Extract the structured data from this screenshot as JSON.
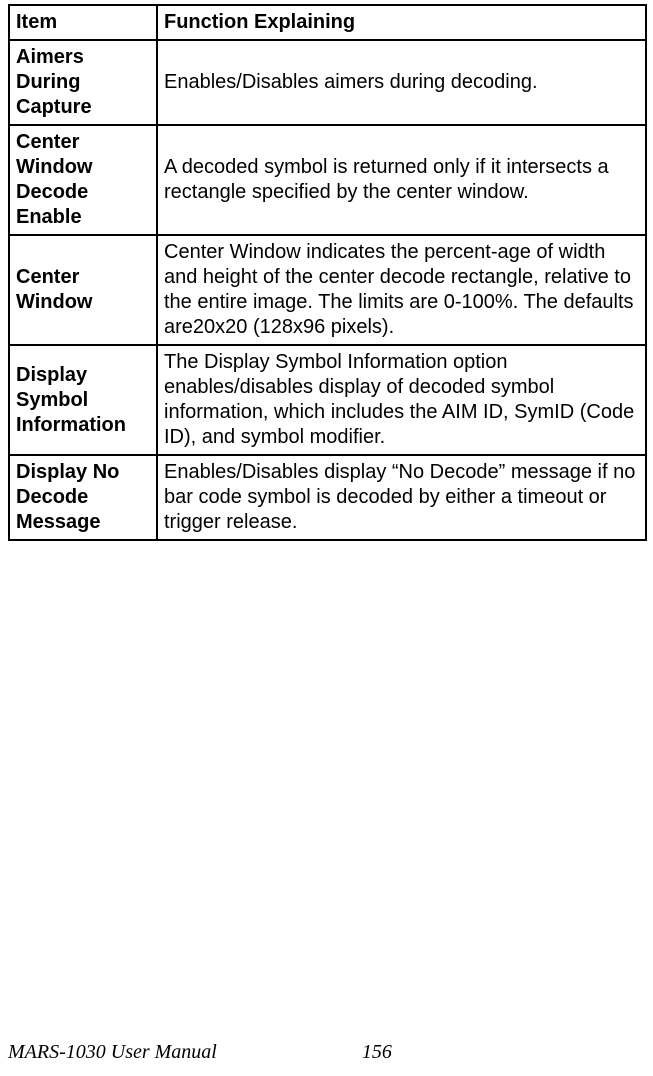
{
  "table": {
    "headers": {
      "item": "Item",
      "explain": "Function Explaining"
    },
    "rows": [
      {
        "item": "Aimers During Capture",
        "explain": "Enables/Disables aimers during decoding."
      },
      {
        "item": "Center Window Decode Enable",
        "explain": "A decoded symbol is returned only if it intersects a rectangle specified by the center window."
      },
      {
        "item": "Center Window",
        "explain": "Center Window indicates the percent-age of width and height of the center decode rectangle, relative to the entire image. The limits are 0-100%. The defaults are20x20 (128x96 pixels)."
      },
      {
        "item": "Display Symbol Information",
        "explain": "The Display Symbol Information option enables/disables display of decoded symbol information, which includes the AIM ID, SymID (Code ID), and symbol modifier."
      },
      {
        "item": "Display No Decode Message",
        "explain": "Enables/Disables display “No Decode” message if no bar code symbol is decoded by either a timeout or trigger release."
      }
    ]
  },
  "footer": {
    "title": "MARS-1030 User Manual",
    "page": "156"
  }
}
